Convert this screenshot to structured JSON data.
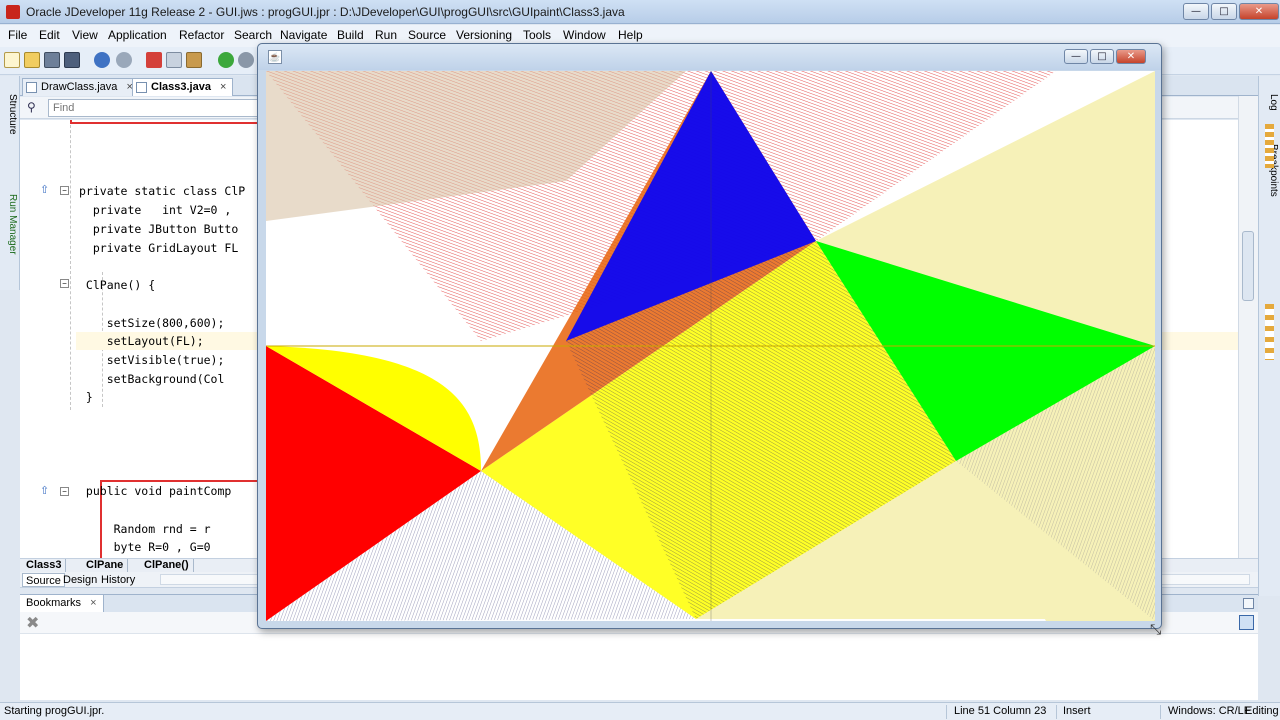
{
  "window": {
    "title": "Oracle JDeveloper 11g Release 2 - GUI.jws : progGUI.jpr : D:\\JDeveloper\\GUI\\progGUI\\src\\GUIpaint\\Class3.java",
    "minimize": "—",
    "maximize": "□",
    "close": "✕"
  },
  "menu": [
    {
      "label": "File"
    },
    {
      "label": "Edit"
    },
    {
      "label": "View"
    },
    {
      "label": "Application"
    },
    {
      "label": "Refactor"
    },
    {
      "label": "Search"
    },
    {
      "label": "Navigate"
    },
    {
      "label": "Build"
    },
    {
      "label": "Run"
    },
    {
      "label": "Source"
    },
    {
      "label": "Versioning"
    },
    {
      "label": "Tools"
    },
    {
      "label": "Window"
    },
    {
      "label": "Help"
    }
  ],
  "left_strip": {
    "structure": "Structure",
    "run_manager": "Run Manager"
  },
  "right_strip": {
    "log": "Log",
    "breakpoints": "Breakpoints"
  },
  "editor_tabs": [
    {
      "label": "DrawClass.java",
      "close": "×"
    },
    {
      "label": "Class3.java",
      "close": "×"
    }
  ],
  "find": {
    "placeholder": "Find"
  },
  "code": {
    "l1": "private static class ClP",
    "l2": "  private   int V2=0 ,",
    "l3": "  private JButton Butto",
    "l4": "  private GridLayout FL",
    "l5": " ClPane() {",
    "l6": "    setSize(800,600);",
    "l7": "    setLayout(FL);",
    "l8": "    setVisible(true);",
    "l9": "    setBackground(Col",
    "l10": " }",
    "l11": " public void paintComp",
    "l12": "     Random rnd = r",
    "l13": "     byte R=0 , G=0"
  },
  "breadcrumb": [
    "Class3",
    "ClPane",
    "ClPane()"
  ],
  "source_tabs": [
    "Source",
    "Design",
    "History"
  ],
  "bookmarks": {
    "tab": "Bookmarks",
    "close": "×"
  },
  "status": {
    "message": "Starting progGUI.jpr.",
    "position": "Line 51 Column 23",
    "mode": "Insert",
    "line_endings": "Windows: CR/LF",
    "state": "Editing"
  },
  "floating_window": {
    "icon": "☕",
    "minimize": "—",
    "maximize": "□",
    "close": "✕"
  },
  "colors": {
    "red": "#ff0000",
    "yellow": "#ffff00",
    "green": "#00ff00",
    "blue": "#0000ff",
    "cream": "#f5f0b0",
    "dark_line": "#1a1a60"
  }
}
